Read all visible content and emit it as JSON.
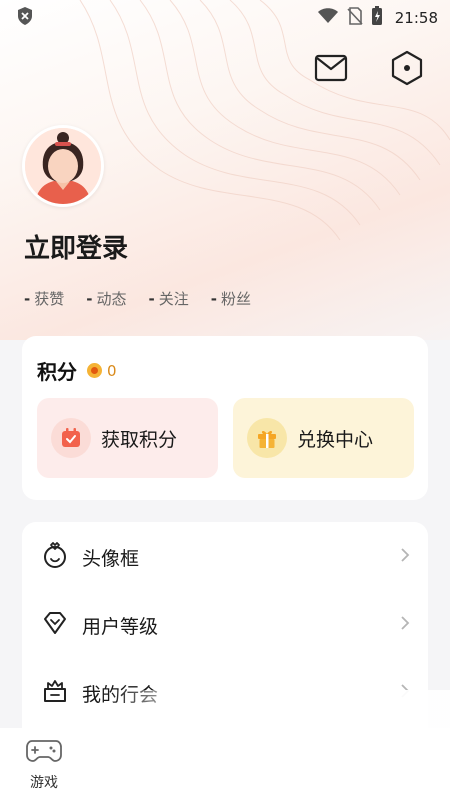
{
  "status_bar": {
    "time": "21:58"
  },
  "profile": {
    "login_label": "立即登录",
    "stats": [
      {
        "value": "-",
        "label": "获赞"
      },
      {
        "value": "-",
        "label": "动态"
      },
      {
        "value": "-",
        "label": "关注"
      },
      {
        "value": "-",
        "label": "粉丝"
      }
    ]
  },
  "points": {
    "title": "积分",
    "value": "0",
    "actions": [
      {
        "label": "获取积分",
        "icon": "calendar-icon",
        "color": "#f2624c"
      },
      {
        "label": "兑换中心",
        "icon": "gift-icon",
        "color": "#f5b335"
      }
    ]
  },
  "menu": {
    "items": [
      {
        "label": "头像框",
        "icon": "avatar-frame-icon"
      },
      {
        "label": "用户等级",
        "icon": "level-badge-icon"
      },
      {
        "label": "我的行会",
        "icon": "guild-icon"
      }
    ]
  },
  "bottom_nav": {
    "game_label": "游戏"
  }
}
